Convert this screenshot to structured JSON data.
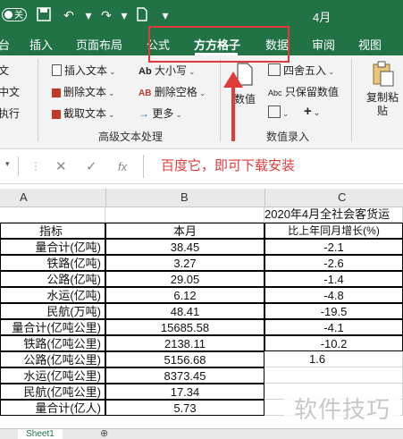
{
  "titlebar": {
    "autosave_label": "关",
    "doc_title": "4月",
    "icons": [
      "save-icon",
      "undo-icon",
      "redo-icon",
      "document-icon",
      "customize-icon"
    ]
  },
  "tabs": [
    {
      "label": "台"
    },
    {
      "label": "插入"
    },
    {
      "label": "页面布局"
    },
    {
      "label": "公式"
    },
    {
      "label": "方方格子"
    },
    {
      "label": "数据"
    },
    {
      "label": "审阅"
    },
    {
      "label": "视图"
    }
  ],
  "ribbon": {
    "left_items": [
      "文",
      "中文",
      "执行"
    ],
    "group1": {
      "insert_text": "插入文本",
      "delete_text": "删除文本",
      "cut_text": "截取文本",
      "case": "大小写",
      "delete_space": "删除空格",
      "more": "更多",
      "group_label": "高级文本处理"
    },
    "group2": {
      "value_label": "数值",
      "round_label": "四舍五入",
      "keep_value": "只保留数值",
      "group_label": "数值录入"
    },
    "copy_paste": "复制粘贴"
  },
  "formula_bar": {
    "fx_label": "fx",
    "content": "百度它，即可下载安装"
  },
  "columns": [
    "A",
    "B",
    "C"
  ],
  "rows": [
    {
      "a": "",
      "b": "",
      "c": "2020年4月全社会客货运"
    },
    {
      "a": "指标",
      "b": "本月",
      "c": "比上年同月增长(%)"
    },
    {
      "a": "量合计(亿吨)",
      "b": "38.45",
      "c": "-2.1"
    },
    {
      "a": "铁路(亿吨)",
      "b": "3.27",
      "c": "-2.6"
    },
    {
      "a": "公路(亿吨)",
      "b": "29.05",
      "c": "-1.4"
    },
    {
      "a": "水运(亿吨)",
      "b": "6.12",
      "c": "-4.8"
    },
    {
      "a": "民航(万吨)",
      "b": "48.41",
      "c": "-19.5"
    },
    {
      "a": "量合计(亿吨公里)",
      "b": "15685.58",
      "c": "-4.1"
    },
    {
      "a": "铁路(亿吨公里)",
      "b": "2138.11",
      "c": "-10.2"
    },
    {
      "a": "公路(亿吨公里)",
      "b": "5156.68",
      "c": "1.6"
    },
    {
      "a": "水运(亿吨公里)",
      "b": "8373.45",
      "c": ""
    },
    {
      "a": "民航(亿吨公里)",
      "b": "17.34",
      "c": ""
    },
    {
      "a": "量合计(亿人)",
      "b": "5.73",
      "c": ""
    }
  ],
  "sheet_tab": "Sheet1",
  "watermark": "软件技巧"
}
